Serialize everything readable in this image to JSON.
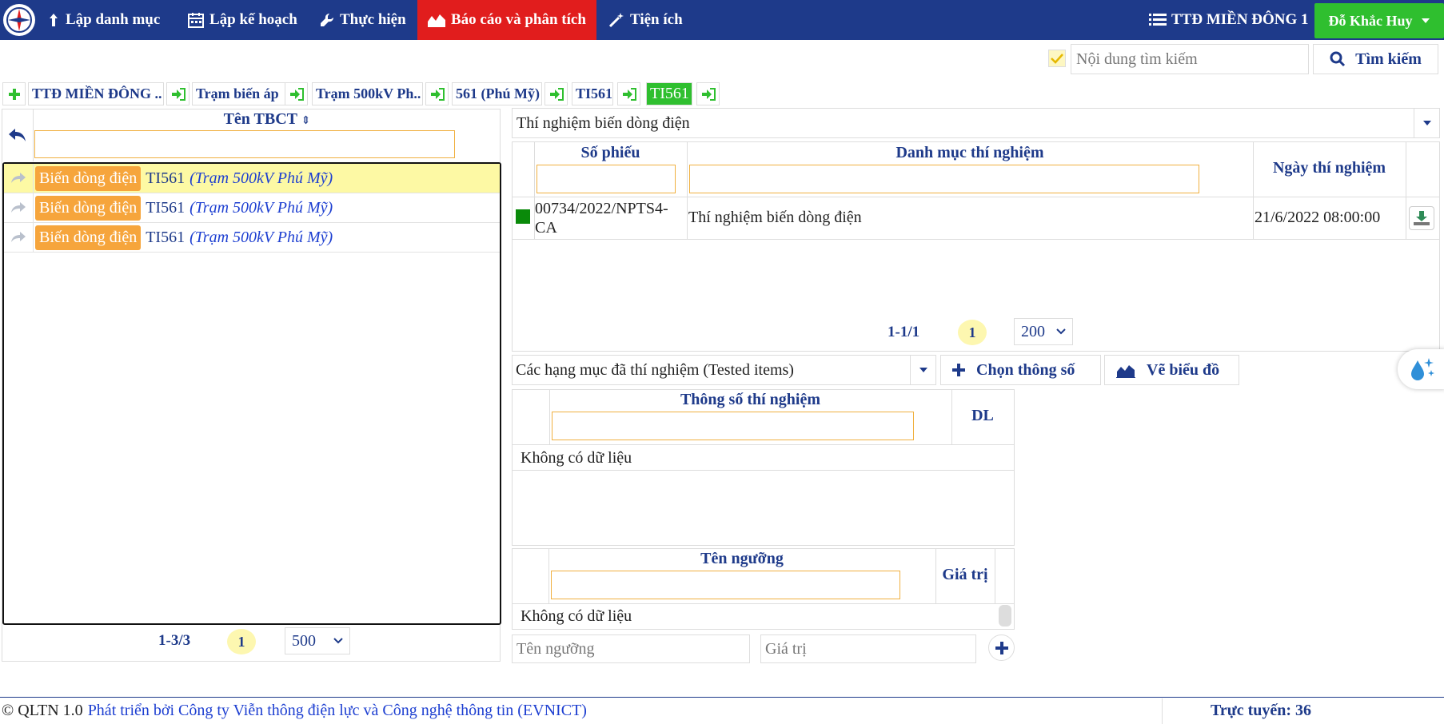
{
  "colors": {
    "navbar": "#1e3a8a",
    "active_menu": "#e11d1d",
    "user_button": "#2fbf2f",
    "badge": "#f6a53c",
    "selected_row": "#fdf9a4",
    "link": "#1e3a8a"
  },
  "navbar": {
    "menu": [
      {
        "label": "Lập danh mục",
        "icon": "upload-arrow-icon"
      },
      {
        "label": "Lập kế hoạch",
        "icon": "calendar-icon"
      },
      {
        "label": "Thực hiện",
        "icon": "wrench-icon"
      },
      {
        "label": "Báo cáo và phân tích",
        "icon": "area-chart-icon",
        "active": true
      },
      {
        "label": "Tiện ích",
        "icon": "magic-wand-icon"
      }
    ],
    "unit_label": "TTĐ MIỀN ĐÔNG 1",
    "user_label": "Đỗ Khắc Huy"
  },
  "search": {
    "placeholder": "Nội dung tìm kiếm",
    "button_label": "Tìm kiếm"
  },
  "breadcrumb": [
    {
      "label": "TTĐ MIỀN ĐÔNG .."
    },
    {
      "label": "Trạm biến áp"
    },
    {
      "label": "Trạm 500kV Ph.."
    },
    {
      "label": "561 (Phú Mỹ)"
    },
    {
      "label": "TI561"
    },
    {
      "label": "TI561",
      "active": true
    }
  ],
  "left_panel": {
    "column_header": "Tên TBCT",
    "rows": [
      {
        "badge": "Biến dòng điện",
        "name": "TI561",
        "station": "(Trạm 500kV Phú Mỹ)",
        "selected": true
      },
      {
        "badge": "Biến dòng điện",
        "name": "TI561",
        "station": "(Trạm 500kV Phú Mỹ)",
        "selected": false
      },
      {
        "badge": "Biến dòng điện",
        "name": "TI561",
        "station": "(Trạm 500kV Phú Mỹ)",
        "selected": false
      }
    ],
    "pager": {
      "count": "1-3/3",
      "page": "1",
      "page_size": "500"
    }
  },
  "tests": {
    "selected_type": "Thí nghiệm biến dòng điện",
    "headers": {
      "so_phieu": "Số phiếu",
      "danh_muc": "Danh mục thí nghiệm",
      "ngay": "Ngày thí nghiệm"
    },
    "rows": [
      {
        "so_phieu_1": "00734/2022/NPTS4-",
        "so_phieu_2": "CA",
        "danh_muc": "Thí nghiệm biến dòng điện",
        "ngay": "21/6/2022 08:00:00"
      }
    ],
    "pager": {
      "count": "1-1/1",
      "page": "1",
      "page_size": "200"
    }
  },
  "items": {
    "selected": "Các hạng mục đã thí nghiệm (Tested items)",
    "choose_button": "Chọn thông số",
    "chart_button": "Vẽ biểu đồ",
    "params_header": "Thông số thí nghiệm",
    "dl_header": "DL",
    "no_data": "Không có dữ liệu"
  },
  "thresholds": {
    "name_header": "Tên ngưỡng",
    "value_header": "Giá trị",
    "no_data": "Không có dữ liệu",
    "name_placeholder": "Tên ngưỡng",
    "value_placeholder": "Giá trị"
  },
  "footer": {
    "copyright": "© QLTN 1.0",
    "developer": "Phát triển bởi Công ty Viễn thông điện lực và Công nghệ thông tin (EVNICT)",
    "online": "Trực tuyến: 36"
  }
}
